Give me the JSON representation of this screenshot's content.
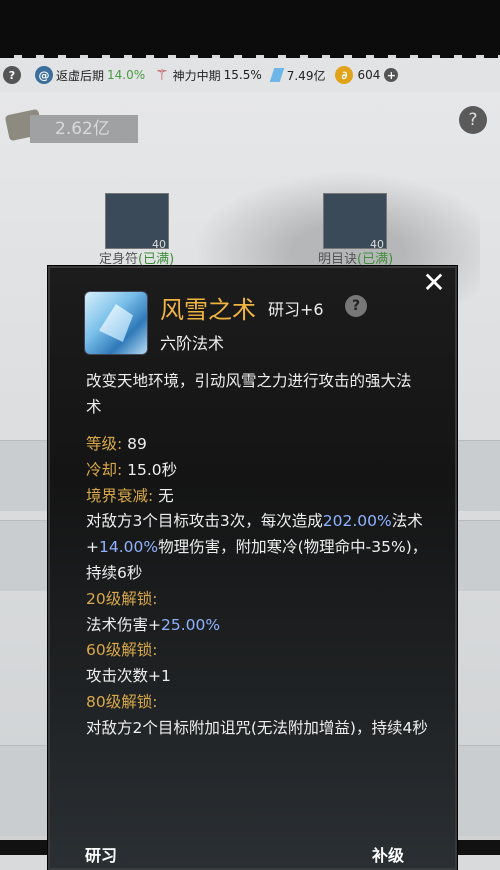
{
  "status": {
    "help": "?",
    "realm1": "返虚后期",
    "realm1_pct": "14.0%",
    "realm2": "神力中期",
    "realm2_pct": "15.5%",
    "crystals": "7.49亿",
    "coins": "604",
    "plus": "+"
  },
  "background": {
    "money": "2.62亿",
    "help": "?",
    "skill_left_level": "40",
    "skill_right_level": "40",
    "skill_left_label": "定身符",
    "skill_left_tag": "(已满)",
    "skill_right_label": "明目诀",
    "skill_right_tag": "(已满)"
  },
  "panel": {
    "title": "风雪之术",
    "level_tag": "研习+6",
    "help": "?",
    "subtype": "六阶法术",
    "description": "改变天地环境，引动风雪之力进行攻击的强大法术",
    "level_label": "等级:",
    "level_value": " 89",
    "cooldown_label": "冷却:",
    "cooldown_value": " 15.0秒",
    "decay_label": "境界衰减:",
    "decay_value": " 无",
    "effect_a": "对敌方3个目标攻击3次，每次造成",
    "effect_pct1": "202.00%",
    "effect_b": "法术+",
    "effect_pct2": "14.00%",
    "effect_c": "物理伤害，附加寒冷(物理命中-35%)，持续6秒",
    "unlock20_label": "20级解锁:",
    "unlock20_a": "法术伤害+",
    "unlock20_pct": "25.00%",
    "unlock60_label": "60级解锁:",
    "unlock60_text": "攻击次数+1",
    "unlock80_label": "80级解锁:",
    "unlock80_text": "对敌方2个目标附加诅咒(无法附加增益)，持续4秒",
    "close": "✕",
    "btn_left": "研习",
    "btn_right": "补级"
  }
}
